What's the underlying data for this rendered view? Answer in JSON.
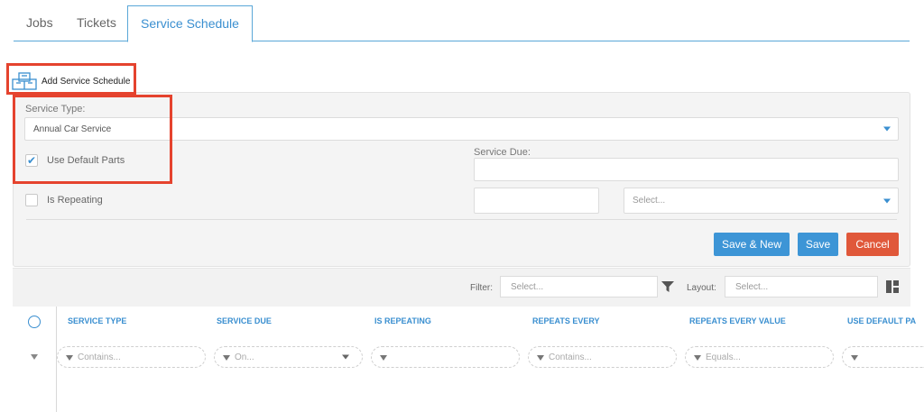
{
  "tabs": [
    {
      "label": "Jobs"
    },
    {
      "label": "Tickets"
    },
    {
      "label": "Service Schedule",
      "active": true
    }
  ],
  "add_button": {
    "label": "Add Service Schedule"
  },
  "form": {
    "service_type_label": "Service Type:",
    "service_type_value": "Annual Car Service",
    "use_default_parts_label": "Use Default Parts",
    "use_default_parts_checked": true,
    "service_due_label": "Service Due:",
    "service_due_value": "",
    "is_repeating_label": "Is Repeating",
    "is_repeating_checked": false,
    "repeat_value": "",
    "repeat_unit_placeholder": "Select...",
    "save_new_label": "Save & New",
    "save_label": "Save",
    "cancel_label": "Cancel"
  },
  "filterbar": {
    "filter_label": "Filter:",
    "filter_placeholder": "Select...",
    "layout_label": "Layout:",
    "layout_placeholder": "Select..."
  },
  "grid": {
    "columns": [
      {
        "header": "SERVICE TYPE",
        "filter_placeholder": "Contains..."
      },
      {
        "header": "SERVICE DUE",
        "filter_placeholder": "On..."
      },
      {
        "header": "IS REPEATING",
        "filter_placeholder": ""
      },
      {
        "header": "REPEATS EVERY",
        "filter_placeholder": "Contains..."
      },
      {
        "header": "REPEATS EVERY VALUE",
        "filter_placeholder": "Equals..."
      },
      {
        "header": "USE DEFAULT PA",
        "filter_placeholder": ""
      }
    ]
  },
  "colors": {
    "accent": "#3a8fd0",
    "danger": "#e0583a",
    "highlight": "#e5432e"
  }
}
